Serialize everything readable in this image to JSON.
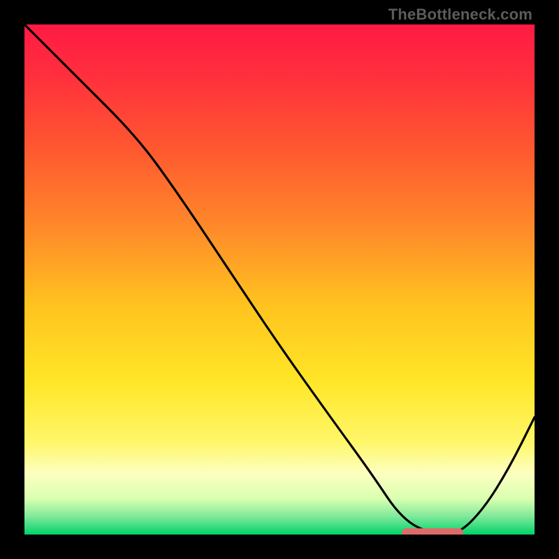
{
  "watermark": "TheBottleneck.com",
  "chart_data": {
    "type": "line",
    "title": "",
    "xlabel": "",
    "ylabel": "",
    "xlim": [
      0,
      100
    ],
    "ylim": [
      0,
      100
    ],
    "grid": false,
    "legend": false,
    "gradient_stops": [
      {
        "offset": 0.0,
        "color": "#ff1a44"
      },
      {
        "offset": 0.1,
        "color": "#ff2f3d"
      },
      {
        "offset": 0.25,
        "color": "#ff5a2f"
      },
      {
        "offset": 0.4,
        "color": "#ff8a2a"
      },
      {
        "offset": 0.55,
        "color": "#ffc31f"
      },
      {
        "offset": 0.7,
        "color": "#ffe627"
      },
      {
        "offset": 0.82,
        "color": "#fff76a"
      },
      {
        "offset": 0.88,
        "color": "#fdffc0"
      },
      {
        "offset": 0.93,
        "color": "#d9ffb0"
      },
      {
        "offset": 0.965,
        "color": "#7fe89a"
      },
      {
        "offset": 1.0,
        "color": "#00d36a"
      }
    ],
    "series": [
      {
        "name": "bottleneck-curve",
        "x": [
          0,
          10,
          22,
          30,
          40,
          50,
          60,
          68,
          74,
          80,
          85,
          90,
          95,
          100
        ],
        "y": [
          100,
          90,
          78,
          67,
          52,
          37,
          23,
          12,
          3,
          0,
          0,
          5,
          13,
          23
        ]
      }
    ],
    "marker": {
      "name": "optimal-range-bar",
      "x_start": 74,
      "x_end": 86,
      "y": 0.4,
      "color": "#e06a6a"
    }
  }
}
